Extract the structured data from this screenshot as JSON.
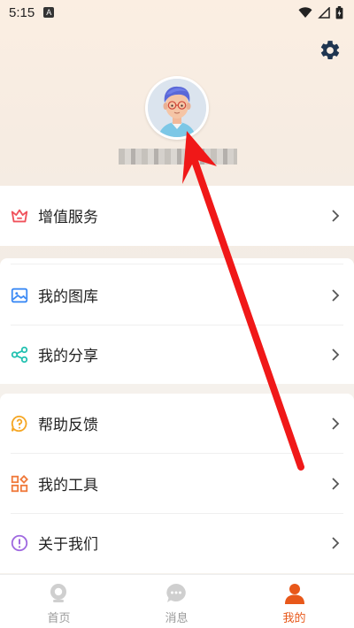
{
  "status_bar": {
    "time": "5:15",
    "notif_letter": "A"
  },
  "menu": {
    "group1": [
      {
        "label": "增值服务",
        "icon": "crown-icon",
        "color": "#f0515b"
      }
    ],
    "group2": [
      {
        "label": "我的图库",
        "icon": "gallery-icon",
        "color": "#3d8bf5"
      },
      {
        "label": "我的分享",
        "icon": "share-icon",
        "color": "#22c1b0"
      }
    ],
    "group3": [
      {
        "label": "帮助反馈",
        "icon": "help-icon",
        "color": "#f5a623"
      },
      {
        "label": "我的工具",
        "icon": "tools-icon",
        "color": "#f07a3c"
      },
      {
        "label": "关于我们",
        "icon": "info-icon",
        "color": "#a06ae0"
      }
    ]
  },
  "tab_bar": {
    "tabs": [
      {
        "label": "首页",
        "icon": "home-camera-icon",
        "active": false
      },
      {
        "label": "消息",
        "icon": "message-icon",
        "active": false
      },
      {
        "label": "我的",
        "icon": "profile-icon",
        "active": true
      }
    ],
    "active_color": "#e8581a",
    "inactive_color": "#9a9a9a"
  },
  "colors": {
    "annotation_arrow": "#f01818"
  }
}
